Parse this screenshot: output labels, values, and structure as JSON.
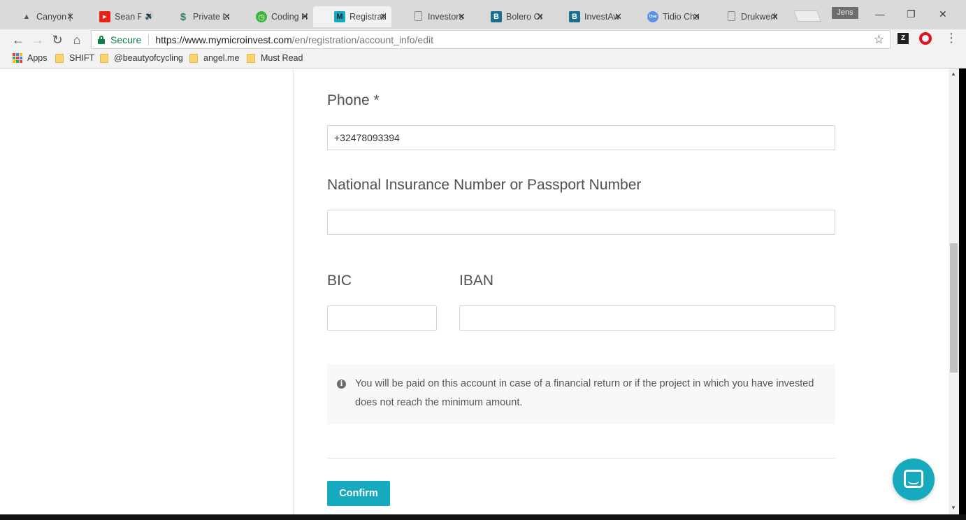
{
  "browser": {
    "tabs": [
      {
        "label": "Canyon |",
        "favicon": "mountain-icon",
        "color": "#555555"
      },
      {
        "label": "Sean P",
        "favicon": "youtube-icon",
        "color": "#e62117"
      },
      {
        "label": "Private La",
        "favicon": "dollar-icon",
        "color": "#2e7d6b"
      },
      {
        "label": "Coding H",
        "favicon": "timer-icon",
        "color": "#3bb53b"
      },
      {
        "label": "Registrati",
        "favicon": "m-icon",
        "color": "#17a9bd"
      },
      {
        "label": "Investors",
        "favicon": "page-icon",
        "color": "#888888"
      },
      {
        "label": "Bolero Cr",
        "favicon": "b-icon",
        "color": "#1b6e8c"
      },
      {
        "label": "InvestAw",
        "favicon": "b-icon",
        "color": "#1b6e8c"
      },
      {
        "label": "Tidio Cha",
        "favicon": "chat-icon",
        "color": "#5c8fe6"
      },
      {
        "label": "Drukwerk",
        "favicon": "page-icon",
        "color": "#888888"
      }
    ],
    "user": "Jens",
    "secure_label": "Secure",
    "url_host": "https://www.mymicroinvest.com",
    "url_path": "/en/registration/account_info/edit",
    "bookmarks": [
      "Apps",
      "SHIFT",
      "@beautyofcycling",
      "angel.me",
      "Must Read"
    ]
  },
  "form": {
    "phone_label": "Phone *",
    "phone_value": "+32478093394",
    "national_id_label": "National Insurance Number or Passport Number",
    "national_id_value": "",
    "bic_label": "BIC",
    "bic_value": "",
    "iban_label": "IBAN",
    "iban_value": "",
    "notice": "You will be paid on this account in case of a financial return or if the project in which you have invested does not reach the minimum amount.",
    "confirm_label": "Confirm"
  },
  "colors": {
    "accent": "#17a9bd",
    "secure_green": "#0b8043"
  }
}
